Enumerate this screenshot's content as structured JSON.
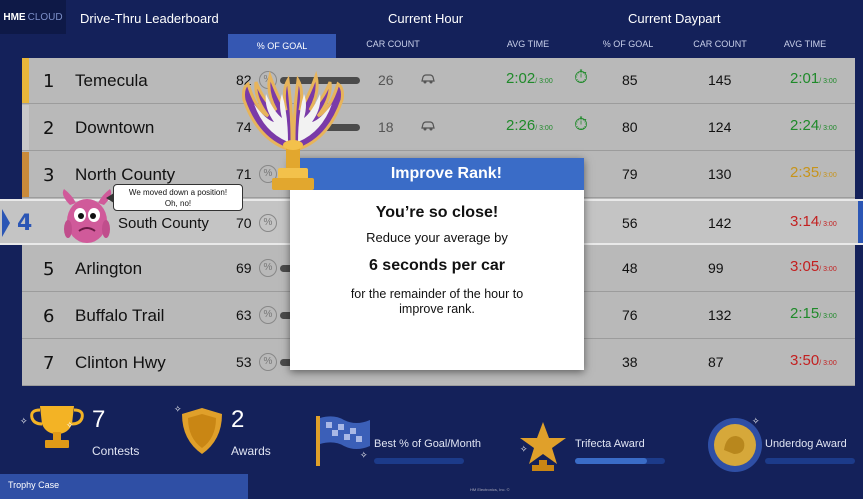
{
  "header": {
    "brand_main": "HME",
    "brand_sub": "CLOUD",
    "title": "Drive-Thru Leaderboard",
    "current_hour": "Current Hour",
    "current_daypart": "Current Daypart"
  },
  "columns": {
    "pct_goal": "% OF GOAL",
    "car_count": "CAR COUNT",
    "avg_time": "AVG TIME",
    "dp_pct_goal": "% OF GOAL",
    "dp_car_count": "CAR COUNT",
    "dp_avg_time": "AVG TIME"
  },
  "rows": [
    {
      "rank": "1",
      "store": "Temecula",
      "pct": "82",
      "cars": "26",
      "avg": "2:02",
      "avg_goal": "/ 3:00",
      "dp_pct": "85",
      "dp_cars": "145",
      "dp_avg": "2:01",
      "dp_goal": "/ 3:00"
    },
    {
      "rank": "2",
      "store": "Downtown",
      "pct": "74",
      "cars": "18",
      "avg": "2:26",
      "avg_goal": "/ 3:00",
      "dp_pct": "80",
      "dp_cars": "124",
      "dp_avg": "2:24",
      "dp_goal": "/ 3:00"
    },
    {
      "rank": "3",
      "store": "North County",
      "pct": "71",
      "dp_pct": "79",
      "dp_cars": "130",
      "dp_avg": "2:35",
      "dp_goal": "/ 3:00"
    },
    {
      "rank": "4",
      "store": "South County",
      "pct": "70",
      "dp_pct": "56",
      "dp_cars": "142",
      "dp_avg": "3:14",
      "dp_goal": "/ 3:00"
    },
    {
      "rank": "5",
      "store": "Arlington",
      "pct": "69",
      "dp_pct": "48",
      "dp_cars": "99",
      "dp_avg": "3:05",
      "dp_goal": "/ 3:00"
    },
    {
      "rank": "6",
      "store": "Buffalo Trail",
      "pct": "63",
      "dp_pct": "76",
      "dp_cars": "132",
      "dp_avg": "2:15",
      "dp_goal": "/ 3:00"
    },
    {
      "rank": "7",
      "store": "Clinton Hwy",
      "pct": "53",
      "dp_pct": "38",
      "dp_cars": "87",
      "dp_avg": "3:50",
      "dp_goal": "/ 3:00"
    }
  ],
  "speech": {
    "line1": "We moved down a position!",
    "line2": "Oh, no!"
  },
  "modal": {
    "title": "Improve Rank!",
    "headline": "You’re so close!",
    "line1": "Reduce your average by",
    "amount": "6 seconds per car",
    "line2": "for the remainder of the hour to improve rank."
  },
  "bottom": {
    "contests_count": "7",
    "contests_label": "Contests",
    "awards_count": "2",
    "awards_label": "Awards",
    "best_pct_label": "Best % of Goal/Month",
    "trifecta_label": "Trifecta Award",
    "underdog_label": "Underdog Award",
    "trophy_case": "Trophy Case",
    "copyright": "HM Electronics, Inc. ©"
  },
  "progress": {
    "best_pct": 0.0,
    "trifecta": 0.8,
    "underdog": 0.0
  },
  "colors": {
    "background": "#14215a",
    "accent": "#3a6cc7",
    "good": "#1f8a2a",
    "warn": "#c7941b",
    "bad": "#c32020",
    "row": "#b9b9b9"
  }
}
